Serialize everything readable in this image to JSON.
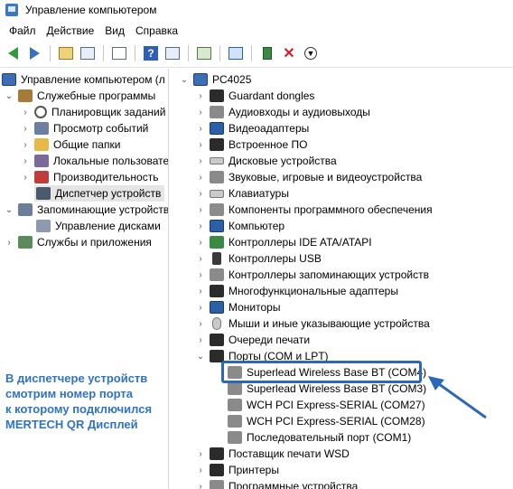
{
  "window": {
    "title": "Управление компьютером"
  },
  "menu": [
    "Файл",
    "Действие",
    "Вид",
    "Справка"
  ],
  "left_tree": [
    {
      "label": "Управление компьютером (л",
      "expander": "",
      "icon": "computer-management-icon"
    },
    {
      "label": "Служебные программы",
      "expander": "v",
      "icon": "tools-icon"
    },
    {
      "label": "Планировщик заданий",
      "expander": ">",
      "icon": "task-scheduler-icon"
    },
    {
      "label": "Просмотр событий",
      "expander": ">",
      "icon": "event-viewer-icon"
    },
    {
      "label": "Общие папки",
      "expander": ">",
      "icon": "shared-folders-icon"
    },
    {
      "label": "Локальные пользовате",
      "expander": ">",
      "icon": "local-users-icon"
    },
    {
      "label": "Производительность",
      "expander": ">",
      "icon": "performance-icon"
    },
    {
      "label": "Диспетчер устройств",
      "expander": "",
      "icon": "device-manager-icon",
      "selected": true
    },
    {
      "label": "Запоминающие устройства",
      "expander": "v",
      "icon": "storage-icon"
    },
    {
      "label": "Управление дисками",
      "expander": "",
      "icon": "disk-management-icon"
    },
    {
      "label": "Службы и приложения",
      "expander": ">",
      "icon": "services-icon"
    }
  ],
  "device_tree": {
    "root": "PC4025",
    "categories": [
      "Guardant dongles",
      "Аудиовходы и аудиовыходы",
      "Видеоадаптеры",
      "Встроенное ПО",
      "Дисковые устройства",
      "Звуковые, игровые и видеоустройства",
      "Клавиатуры",
      "Компоненты программного обеспечения",
      "Компьютер",
      "Контроллеры IDE ATA/ATAPI",
      "Контроллеры USB",
      "Контроллеры запоминающих устройств",
      "Многофункциональные адаптеры",
      "Мониторы",
      "Мыши и иные указывающие устройства",
      "Очереди печати"
    ],
    "ports_category": "Порты (COM и LPT)",
    "ports": [
      "Superlead Wireless Base BT (COM4)",
      "Superlead Wireless Base BT (COM3)",
      "WCH PCI Express-SERIAL (COM27)",
      "WCH PCI Express-SERIAL (COM28)",
      "Последовательный порт (COM1)"
    ],
    "after_ports": [
      "Поставщик печати WSD",
      "Принтеры",
      "Программные устройства"
    ]
  },
  "annotation": {
    "lines": [
      "В диспетчере устройств",
      "смотрим номер порта",
      "к которому подключился",
      "MERTECH QR Дисплей"
    ],
    "color": "#2f73c4"
  },
  "highlight_color": "#2b68b8"
}
